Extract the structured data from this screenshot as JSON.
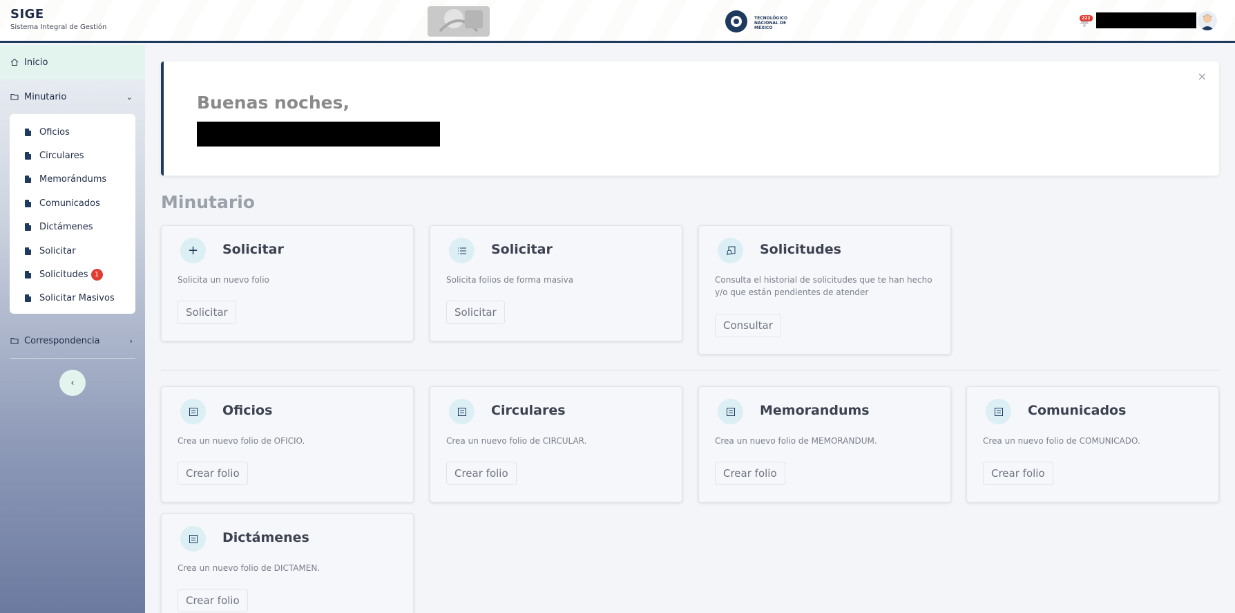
{
  "header": {
    "app_title": "SIGE",
    "app_subtitle": "Sistema Integral de Gestión",
    "tec_logo_text": "TECNOLÓGICO NACIONAL DE MÉXICO",
    "notification_count": "222",
    "icons": [
      "government-emblem-logo",
      "tecnm-logo",
      "bell-icon",
      "user-avatar"
    ]
  },
  "sidebar": {
    "inicio": "Inicio",
    "minutario": "Minutario",
    "submenu": [
      {
        "label": "Oficios"
      },
      {
        "label": "Circulares"
      },
      {
        "label": "Memorándums"
      },
      {
        "label": "Comunicados"
      },
      {
        "label": "Dictámenes"
      },
      {
        "label": "Solicitar"
      },
      {
        "label": "Solicitudes",
        "badge": "1"
      },
      {
        "label": "Solicitar Masivos"
      }
    ],
    "correspondencia": "Correspondencia",
    "collapse_glyph": "‹"
  },
  "welcome": {
    "greeting": "Buenas noches,",
    "close_glyph": "×"
  },
  "section": {
    "title": "Minutario"
  },
  "actions": [
    {
      "title": "Solicitar",
      "description": "Solicita un nuevo folio",
      "button": "Solicitar",
      "icon": "plus-icon"
    },
    {
      "title": "Solicitar",
      "description": "Solicita folios de forma masiva",
      "button": "Solicitar",
      "icon": "list-icon"
    },
    {
      "title": "Solicitudes",
      "description": "Consulta el historial de solicitudes que te han hecho y/o que están pendientes de atender",
      "button": "Consultar",
      "icon": "search-document-icon"
    }
  ],
  "folios": [
    {
      "title": "Oficios",
      "description": "Crea un nuevo folio de OFICIO.",
      "button": "Crear folio"
    },
    {
      "title": "Circulares",
      "description": "Crea un nuevo folio de CIRCULAR.",
      "button": "Crear folio"
    },
    {
      "title": "Memorandums",
      "description": "Crea un nuevo folio de MEMORANDUM.",
      "button": "Crear folio"
    },
    {
      "title": "Comunicados",
      "description": "Crea un nuevo folio de COMUNICADO.",
      "button": "Crear folio"
    },
    {
      "title": "Dictámenes",
      "description": "Crea un nuevo folio de DICTAMEN.",
      "button": "Crear folio"
    }
  ],
  "colors": {
    "primary": "#1f3a5f",
    "active_bg": "#e3f4ee",
    "badge": "#e03c31",
    "icon_bg": "#dbeff4"
  }
}
